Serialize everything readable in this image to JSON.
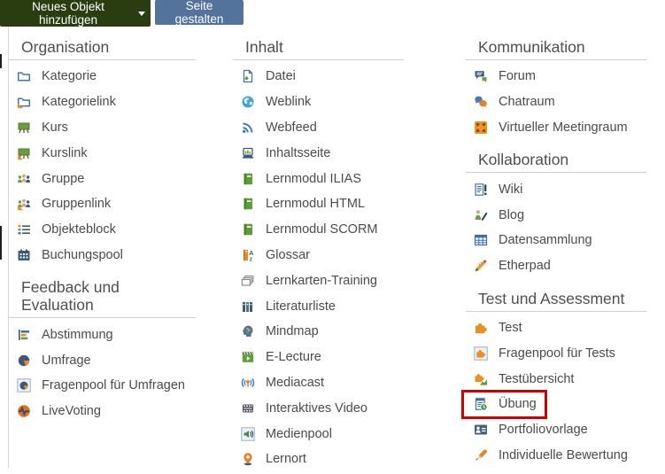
{
  "toolbar": {
    "add_object_label": "Neues Objekt hinzufügen",
    "design_page_label": "Seite gestalten"
  },
  "colors": {
    "add_button_bg": "#2a3d10",
    "design_button_bg": "#53739c",
    "highlight_border": "#d10000"
  },
  "menu": {
    "columns": [
      {
        "sections": [
          {
            "title": "Organisation",
            "items": [
              {
                "label": "Kategorie",
                "icon": "folder"
              },
              {
                "label": "Kategorielink",
                "icon": "folder-link"
              },
              {
                "label": "Kurs",
                "icon": "course"
              },
              {
                "label": "Kurslink",
                "icon": "course-link"
              },
              {
                "label": "Gruppe",
                "icon": "group"
              },
              {
                "label": "Gruppenlink",
                "icon": "group-link"
              },
              {
                "label": "Objekteblock",
                "icon": "objectblock"
              },
              {
                "label": "Buchungspool",
                "icon": "bookingpool"
              }
            ]
          },
          {
            "title": "Feedback und Evaluation",
            "items": [
              {
                "label": "Abstimmung",
                "icon": "poll"
              },
              {
                "label": "Umfrage",
                "icon": "survey"
              },
              {
                "label": "Fragenpool für Umfragen",
                "icon": "survey-pool"
              },
              {
                "label": "LiveVoting",
                "icon": "livevoting"
              }
            ]
          }
        ]
      },
      {
        "sections": [
          {
            "title": "Inhalt",
            "items": [
              {
                "label": "Datei",
                "icon": "file"
              },
              {
                "label": "Weblink",
                "icon": "weblink"
              },
              {
                "label": "Webfeed",
                "icon": "webfeed"
              },
              {
                "label": "Inhaltsseite",
                "icon": "contentpage"
              },
              {
                "label": "Lernmodul ILIAS",
                "icon": "learning-module"
              },
              {
                "label": "Lernmodul HTML",
                "icon": "learning-module"
              },
              {
                "label": "Lernmodul SCORM",
                "icon": "learning-module"
              },
              {
                "label": "Glossar",
                "icon": "glossary"
              },
              {
                "label": "Lernkarten-Training",
                "icon": "flashcards"
              },
              {
                "label": "Literaturliste",
                "icon": "bibliography"
              },
              {
                "label": "Mindmap",
                "icon": "mindmap"
              },
              {
                "label": "E-Lecture",
                "icon": "e-lecture"
              },
              {
                "label": "Mediacast",
                "icon": "mediacast"
              },
              {
                "label": "Interaktives Video",
                "icon": "interactive-video"
              },
              {
                "label": "Medienpool",
                "icon": "mediapool"
              },
              {
                "label": "Lernort",
                "icon": "learning-location"
              }
            ]
          }
        ]
      },
      {
        "sections": [
          {
            "title": "Kommunikation",
            "items": [
              {
                "label": "Forum",
                "icon": "forum"
              },
              {
                "label": "Chatraum",
                "icon": "chatroom"
              },
              {
                "label": "Virtueller Meetingraum",
                "icon": "meeting-room"
              }
            ]
          },
          {
            "title": "Kollaboration",
            "items": [
              {
                "label": "Wiki",
                "icon": "wiki"
              },
              {
                "label": "Blog",
                "icon": "blog"
              },
              {
                "label": "Datensammlung",
                "icon": "data-collection"
              },
              {
                "label": "Etherpad",
                "icon": "etherpad"
              }
            ]
          },
          {
            "title": "Test und Assessment",
            "items": [
              {
                "label": "Test",
                "icon": "test"
              },
              {
                "label": "Fragenpool für Tests",
                "icon": "test-pool"
              },
              {
                "label": "Testübersicht",
                "icon": "test-overview"
              },
              {
                "label": "Übung",
                "icon": "exercise",
                "highlighted": true
              },
              {
                "label": "Portfoliovorlage",
                "icon": "portfolio-template"
              },
              {
                "label": "Individuelle Bewertung",
                "icon": "individual-assessment"
              }
            ]
          }
        ]
      }
    ]
  }
}
